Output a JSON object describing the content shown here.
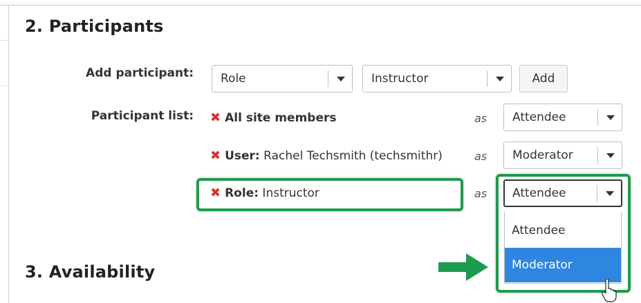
{
  "sections": {
    "participants_title": "2. Participants",
    "availability_title": "3. Availability"
  },
  "add_participant": {
    "label": "Add participant:",
    "type_select": "Role",
    "value_select": "Instructor",
    "add_button": "Add"
  },
  "participant_list": {
    "label": "Participant list:",
    "as_label": "as",
    "rows": [
      {
        "prefix": "All site members",
        "name": "",
        "role": "Attendee"
      },
      {
        "prefix": "User:",
        "name": " Rachel Techsmith (techsmithr)",
        "role": "Moderator"
      },
      {
        "prefix": "Role:",
        "name": " Instructor",
        "role": "Attendee"
      }
    ]
  },
  "role_dropdown": {
    "options": [
      "Attendee",
      "Moderator"
    ],
    "highlighted": "Moderator"
  },
  "colors": {
    "remove_icon": "#d9302c",
    "highlight_border": "#1e9a4e",
    "selected_option": "#2e86e0"
  }
}
